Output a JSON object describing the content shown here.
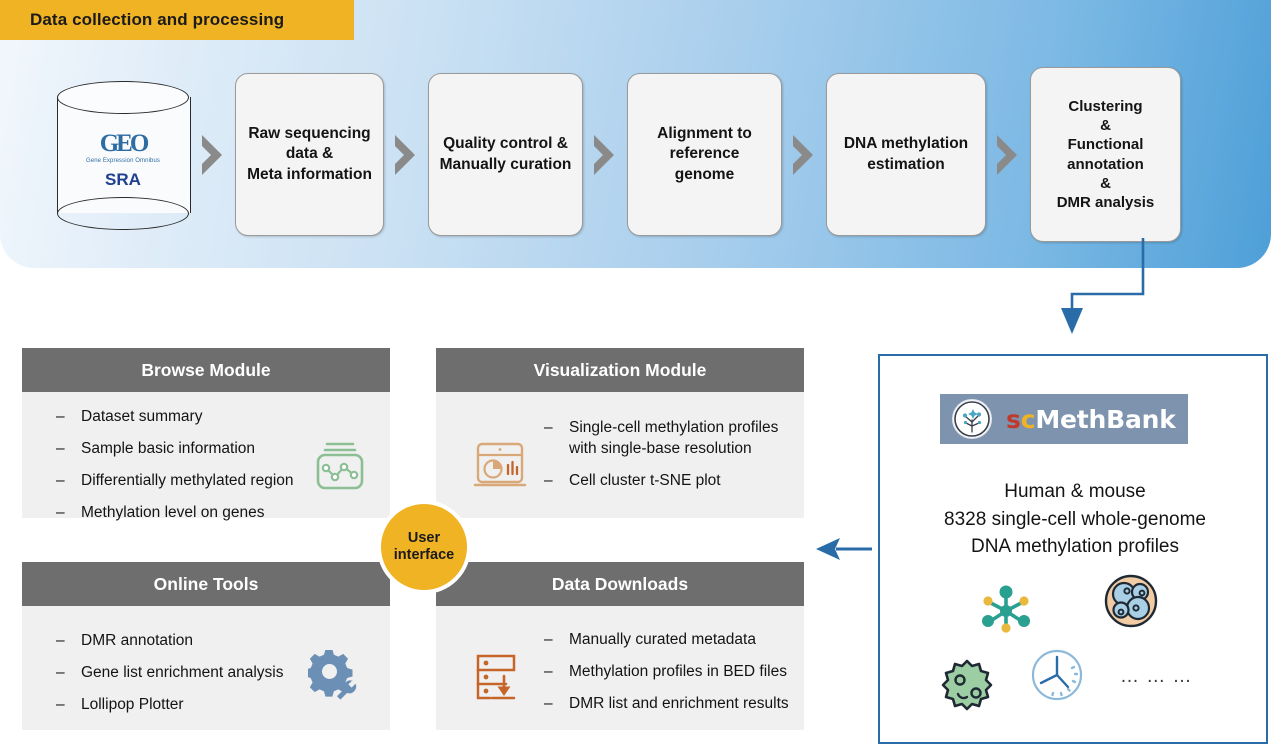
{
  "top": {
    "banner_label": "Data collection and processing",
    "source": {
      "logo_text": "GEO",
      "logo_subtitle": "Gene Expression Omnibus",
      "label": "SRA"
    },
    "steps": [
      {
        "label": "Raw sequencing\ndata &\nMeta information"
      },
      {
        "label": "Quality control &\nManually curation"
      },
      {
        "label": "Alignment to\nreference\ngenome"
      },
      {
        "label": "DNA methylation\nestimation"
      },
      {
        "label": "Clustering\n&\nFunctional\nannotation\n&\nDMR analysis"
      }
    ]
  },
  "modules": [
    {
      "title": "Browse Module",
      "items": [
        "Dataset summary",
        "Sample basic information",
        "Differentially methylated region",
        "Methylation level on genes"
      ]
    },
    {
      "title": "Visualization Module",
      "items": [
        "Single-cell methylation profiles with single-base resolution",
        "Cell cluster t-SNE plot"
      ]
    },
    {
      "title": "Online Tools",
      "items": [
        "DMR annotation",
        "Gene list enrichment analysis",
        "Lollipop Plotter"
      ]
    },
    {
      "title": "Data Downloads",
      "items": [
        "Manually curated metadata",
        "Methylation profiles in BED files",
        "DMR list and enrichment results"
      ]
    }
  ],
  "user_interface": {
    "line1": "User",
    "line2": "interface"
  },
  "bank": {
    "logo_s": "s",
    "logo_c": "c",
    "logo_rest": "MethBank",
    "description_line1": "Human & mouse",
    "description_line2": "8328 single-cell whole-genome",
    "description_line3": "DNA methylation profiles",
    "ellipsis": "… … …"
  },
  "colors": {
    "banner": "#f0b323",
    "panel_blue_start": "#f2f7fc",
    "panel_blue_end": "#4e9fd8",
    "module_header": "#6e6e6e",
    "module_body": "#f0f0f0",
    "accent_blue": "#2a6ca8",
    "logo_bg": "#7e93ae",
    "logo_s": "#c0392b",
    "logo_c": "#f0b323",
    "icon_green": "#8cbf93",
    "icon_orange": "#c5652a",
    "icon_steel": "#6c8fb5"
  }
}
